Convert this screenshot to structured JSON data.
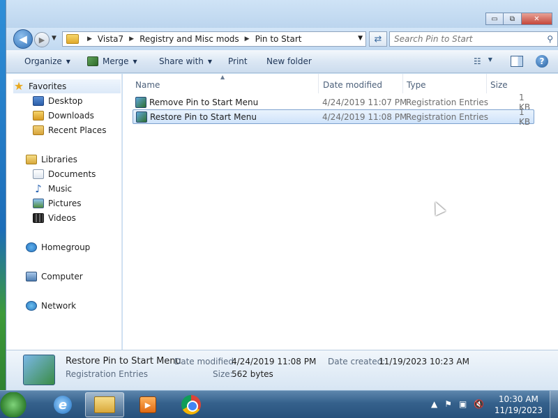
{
  "window": {
    "caption_buttons": {
      "minimize": "▭",
      "maximize": "⧉",
      "close": "✕"
    }
  },
  "address": {
    "crumbs": [
      "Vista7",
      "Registry and Misc mods",
      "Pin to Start"
    ],
    "search_placeholder": "Search Pin to Start"
  },
  "commands": {
    "organize": "Organize",
    "merge": "Merge",
    "share_with": "Share with",
    "print": "Print",
    "new_folder": "New folder"
  },
  "nav": {
    "favorites": "Favorites",
    "desktop": "Desktop",
    "downloads": "Downloads",
    "recent_places": "Recent Places",
    "libraries": "Libraries",
    "documents": "Documents",
    "music": "Music",
    "pictures": "Pictures",
    "videos": "Videos",
    "homegroup": "Homegroup",
    "computer": "Computer",
    "network": "Network"
  },
  "columns": {
    "name": "Name",
    "date_modified": "Date modified",
    "type": "Type",
    "size": "Size"
  },
  "files": [
    {
      "name": "Remove Pin to Start Menu",
      "date": "4/24/2019 11:07 PM",
      "type": "Registration Entries",
      "size": "1 KB"
    },
    {
      "name": "Restore Pin to Start Menu",
      "date": "4/24/2019 11:08 PM",
      "type": "Registration Entries",
      "size": "1 KB"
    }
  ],
  "details": {
    "name": "Restore Pin to Start Menu",
    "type": "Registration Entries",
    "date_modified_label": "Date modified:",
    "date_modified": "4/24/2019 11:08 PM",
    "date_created_label": "Date created:",
    "date_created": "11/19/2023 10:23 AM",
    "size_label": "Size:",
    "size": "562 bytes"
  },
  "taskbar": {
    "time": "10:30 AM",
    "date": "11/19/2023"
  },
  "colors": {
    "selection_border": "#7da2ce",
    "selection_fill": "#cfe3fa",
    "taskbar": "#35618c"
  }
}
